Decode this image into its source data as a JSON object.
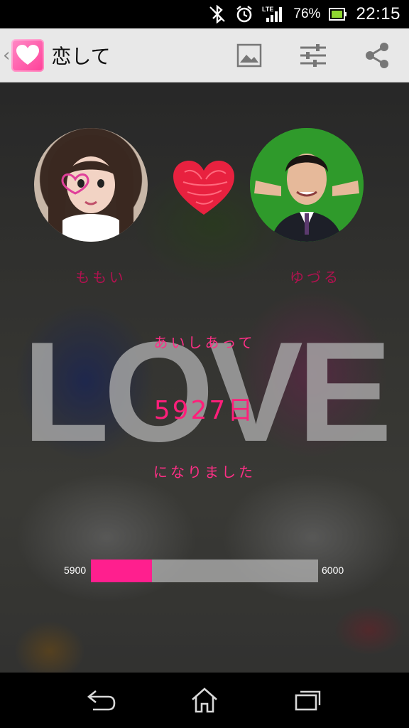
{
  "status_bar": {
    "icons": [
      "bluetooth-icon",
      "alarm-icon",
      "lte-signal-icon",
      "battery-icon"
    ],
    "network_label": "LTE",
    "battery_percent": "76%",
    "time": "22:15"
  },
  "action_bar": {
    "title": "恋して",
    "icons": [
      "app-heart-logo-icon",
      "image-icon",
      "sliders-icon",
      "share-icon"
    ]
  },
  "couple": {
    "left_name": "ももい",
    "right_name": "ゆづる"
  },
  "background_text": "LOVE",
  "counter": {
    "line1": "あいしあって",
    "days": "5927日",
    "line2": "になりました"
  },
  "progress": {
    "min_label": "5900",
    "max_label": "6000",
    "value": 5927,
    "min": 5900,
    "max": 6000
  },
  "colors": {
    "accent": "#ff1f8e",
    "text_pink": "#ff2f86",
    "name_color": "#b0124f"
  },
  "navigation": {
    "icons": [
      "back-icon",
      "home-icon",
      "recent-apps-icon"
    ]
  }
}
